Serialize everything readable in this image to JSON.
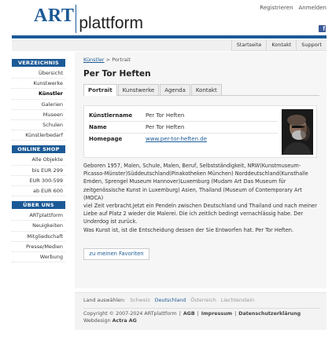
{
  "header": {
    "logo_art": "ART",
    "logo_plattform": "plattform",
    "links": [
      "Registrieren",
      "Anmelden"
    ],
    "facebook_icon": "f"
  },
  "top_nav": [
    "Startseite",
    "Kontakt",
    "Support"
  ],
  "sidebar": {
    "sections": [
      {
        "title": "VERZEICHNIS",
        "items": [
          "Übersicht",
          "Kunstwerke",
          "Künstler",
          "Galerien",
          "Museen",
          "Schulen",
          "Künstlerbedarf"
        ],
        "active": "Künstler"
      },
      {
        "title": "ONLINE SHOP",
        "items": [
          "Alle Objekte",
          "bis EUR 299",
          "EUR 300-599",
          "ab EUR 600"
        ]
      },
      {
        "title": "ÜBER UNS",
        "items": [
          "ARTplattform",
          "Neuigkeiten",
          "Mitgliedschaft",
          "Presse/Medien",
          "Werbung"
        ]
      }
    ]
  },
  "breadcrumb": {
    "link": "Künstler",
    "separator": ">",
    "current": "Portrait"
  },
  "page_title": "Per Tor Heften",
  "tabs": [
    {
      "label": "Portrait",
      "active": true
    },
    {
      "label": "Kunstwerke",
      "active": false
    },
    {
      "label": "Agenda",
      "active": false
    },
    {
      "label": "Kontakt",
      "active": false
    }
  ],
  "info": {
    "rows": [
      {
        "key": "Künstlername",
        "value": "Per Tor Heften"
      },
      {
        "key": "Name",
        "value": "Per Tor Heften"
      },
      {
        "key": "Homepage",
        "value": "www.per-tor-heften.de"
      }
    ]
  },
  "bio": [
    "Geboren 1957, Malen, Schule, Malen, Beruf, Selbstständigkeit, NRW(Kunstmuseum-Picasso-Münster)Süddeutschland(Pinakotheken München) Norddeutschland(Kunsthalle Emden, Sprengel Museum Hannover)Luxemburg (Mudam Art Das Museum für zeitgenössische Kunst in Luxemburg) Asien, Thailand (Museum of Contemporary Art (MOCA)",
    "viel Zeit verbracht.Jetzt ein Pendeln zwischen Deutschland und Thailand und nach meiner Liebe auf Platz 2 wieder die Malerei. Die ich zeitlich bedingt vernachlässig habe. Der Underdog ist zurück.",
    "Was Kunst ist, ist die Entscheidung dessen der Sie Entworfen hat. Per Tor Heften."
  ],
  "favorites_button": "zu meinen Favoriten",
  "footer": {
    "country_label": "Land auswählen:",
    "countries": [
      {
        "name": "Schweiz",
        "active": false
      },
      {
        "name": "Deutschland",
        "active": true
      },
      {
        "name": "Österreich",
        "active": false
      },
      {
        "name": "Liechtenstein",
        "active": false
      }
    ],
    "copyright": "Copyright © 2007-2024 ARTplattform",
    "sep": "|",
    "links": [
      "AGB",
      "Impressum",
      "Datenschutzerklärung"
    ],
    "webdesign_label": "Webdesign",
    "webdesign_name": "Actra AG"
  },
  "colors": {
    "brand": "#1c5a96",
    "facebook": "#3b5998"
  }
}
